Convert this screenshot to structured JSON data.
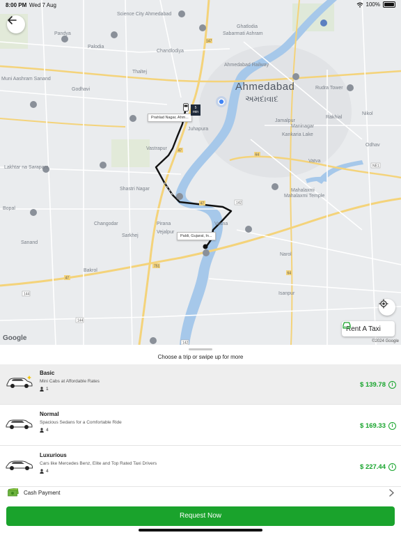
{
  "status_bar": {
    "time": "8:00 PM",
    "date": "Wed 7 Aug",
    "battery": "100%"
  },
  "map": {
    "city_name": "Ahmedabad",
    "city_name_gujarati": "અમદાવાદ",
    "pickup_label": "Prahlad Nagar, Ahm...",
    "dropoff_label": "Paldi, Gujarat, In...",
    "eta_value": "5",
    "eta_unit": "min",
    "labels": [
      "Science City Ahmedabad",
      "Palodia",
      "Pandya",
      "Godhavi",
      "Muni Aashram Sanand",
      "Sabarmati Ashram",
      "Ahmedabad Railway",
      "Jamalpur",
      "Maninagar",
      "Vatva",
      "Narol",
      "Mahalaxmi",
      "Ghatlodia",
      "Vasna",
      "Sarkhej",
      "Changodar",
      "Lakhtar na Sarapara",
      "Bakrol",
      "Pirana",
      "Shastri Nagar",
      "Bopal",
      "Vastrapur",
      "Thaltej",
      "Isanpur",
      "Nikol",
      "Odhav",
      "Rakhial",
      "Vejalpur",
      "Juhapura",
      "Chandlodiya",
      "Sanand",
      "Rudra Tower",
      "Kankaria Lake",
      "Mahalaxmi Temple"
    ],
    "rent_a_taxi": "Rent A Taxi",
    "google": "Google",
    "copyright": "©2024 Google"
  },
  "sheet": {
    "title": "Choose a trip or swipe up for more",
    "rides": [
      {
        "name": "Basic",
        "description": "Mini Cabs at Affordable Rates",
        "seats": "1",
        "price": "$ 139.78"
      },
      {
        "name": "Normal",
        "description": "Spacious Sedans for a Comfortable Ride",
        "seats": "4",
        "price": "$ 169.33"
      },
      {
        "name": "Luxurious",
        "description": "Cars like Mercedes Benz, Elite and Top Rated Taxi Drivers",
        "seats": "4",
        "price": "$ 227.44"
      }
    ],
    "payment_label": "Cash Payment",
    "request_button": "Request Now"
  },
  "colors": {
    "accent": "#1aa32c",
    "price": "#17a42c",
    "river": "#a6c8ea",
    "route": "#111111"
  }
}
